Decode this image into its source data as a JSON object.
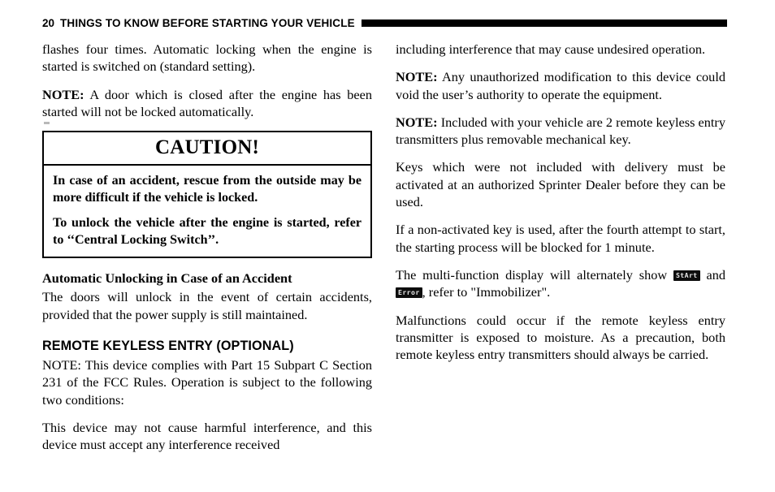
{
  "header": {
    "folio": "20",
    "title": "THINGS TO KNOW BEFORE STARTING YOUR VEHICLE"
  },
  "left_column": {
    "para_flashes": "flashes four times. Automatic locking when the engine is started is switched on (standard setting).",
    "note_door_label": "NOTE:",
    "note_door_text": " A door which is closed after the engine has been started will not be locked automatically.",
    "caution": {
      "title": "CAUTION!",
      "para1": "In case of an accident, rescue from the outside may be more difficult if the vehicle is locked.",
      "para2": "To unlock the vehicle after the engine is started, refer to ‘‘Central Locking Switch’’."
    },
    "subheading_auto_unlocking": "Automatic Unlocking in Case of an Accident",
    "para_doors_unlock": "The doors will unlock in the event of certain accidents, provided that the power supply is still maintained.",
    "section_heading": "REMOTE KEYLESS ENTRY (OPTIONAL)",
    "para_fcc": "NOTE: This device complies with Part 15 Subpart C Section 231 of the FCC Rules. Operation is subject to the following two conditions:",
    "para_conditions": "This device may not cause harmful interference, and this device must accept any interference received"
  },
  "right_column": {
    "para_including": "including interference that may cause undesired operation.",
    "note_modification_label": "NOTE:",
    "note_modification_text": " Any unauthorized modification to this device could void the user’s authority to operate the equipment.",
    "note_included_label": "NOTE:",
    "note_included_text": " Included with your vehicle are 2 remote keyless entry transmitters plus removable mechanical key.",
    "para_keys_activated": "Keys which were not included with delivery must be activated at an authorized Sprinter Dealer before they can be used.",
    "para_non_activated": "If a non-activated key is used, after the fourth attempt to start, the starting process will be blocked for 1 minute.",
    "para_display_part1": "The multi-function display will alternately show ",
    "display_badge_start": "StArt",
    "para_display_part2": " and ",
    "display_badge_error": "Error",
    "para_display_part3": ", refer to \"Immobilizer\".",
    "para_malfunctions": "Malfunctions could occur if the remote keyless entry transmitter is exposed to moisture. As a precaution, both remote keyless entry transmitters should always be carried."
  },
  "colors": {
    "ink": "#000000",
    "page": "#ffffff",
    "lcd_background": "#0d0d0d",
    "lcd_text": "#e8e8e8"
  }
}
